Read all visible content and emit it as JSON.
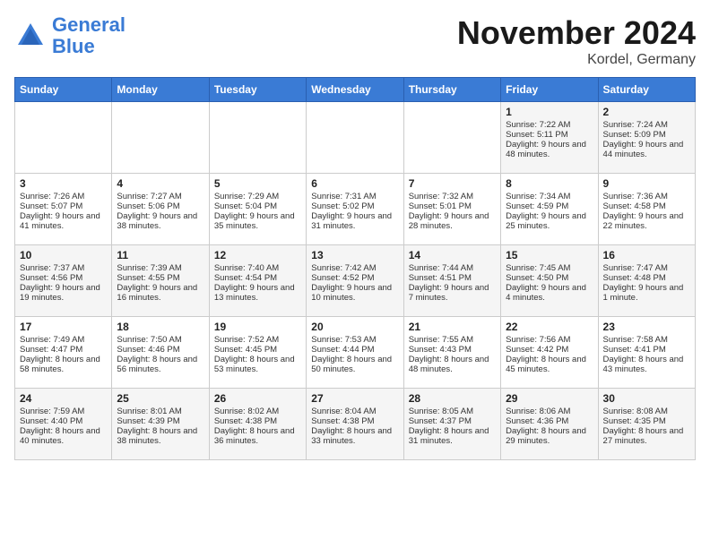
{
  "header": {
    "logo_line1": "General",
    "logo_line2": "Blue",
    "month": "November 2024",
    "location": "Kordel, Germany"
  },
  "days_of_week": [
    "Sunday",
    "Monday",
    "Tuesday",
    "Wednesday",
    "Thursday",
    "Friday",
    "Saturday"
  ],
  "weeks": [
    [
      {
        "day": "",
        "content": ""
      },
      {
        "day": "",
        "content": ""
      },
      {
        "day": "",
        "content": ""
      },
      {
        "day": "",
        "content": ""
      },
      {
        "day": "",
        "content": ""
      },
      {
        "day": "1",
        "content": "Sunrise: 7:22 AM\nSunset: 5:11 PM\nDaylight: 9 hours and 48 minutes."
      },
      {
        "day": "2",
        "content": "Sunrise: 7:24 AM\nSunset: 5:09 PM\nDaylight: 9 hours and 44 minutes."
      }
    ],
    [
      {
        "day": "3",
        "content": "Sunrise: 7:26 AM\nSunset: 5:07 PM\nDaylight: 9 hours and 41 minutes."
      },
      {
        "day": "4",
        "content": "Sunrise: 7:27 AM\nSunset: 5:06 PM\nDaylight: 9 hours and 38 minutes."
      },
      {
        "day": "5",
        "content": "Sunrise: 7:29 AM\nSunset: 5:04 PM\nDaylight: 9 hours and 35 minutes."
      },
      {
        "day": "6",
        "content": "Sunrise: 7:31 AM\nSunset: 5:02 PM\nDaylight: 9 hours and 31 minutes."
      },
      {
        "day": "7",
        "content": "Sunrise: 7:32 AM\nSunset: 5:01 PM\nDaylight: 9 hours and 28 minutes."
      },
      {
        "day": "8",
        "content": "Sunrise: 7:34 AM\nSunset: 4:59 PM\nDaylight: 9 hours and 25 minutes."
      },
      {
        "day": "9",
        "content": "Sunrise: 7:36 AM\nSunset: 4:58 PM\nDaylight: 9 hours and 22 minutes."
      }
    ],
    [
      {
        "day": "10",
        "content": "Sunrise: 7:37 AM\nSunset: 4:56 PM\nDaylight: 9 hours and 19 minutes."
      },
      {
        "day": "11",
        "content": "Sunrise: 7:39 AM\nSunset: 4:55 PM\nDaylight: 9 hours and 16 minutes."
      },
      {
        "day": "12",
        "content": "Sunrise: 7:40 AM\nSunset: 4:54 PM\nDaylight: 9 hours and 13 minutes."
      },
      {
        "day": "13",
        "content": "Sunrise: 7:42 AM\nSunset: 4:52 PM\nDaylight: 9 hours and 10 minutes."
      },
      {
        "day": "14",
        "content": "Sunrise: 7:44 AM\nSunset: 4:51 PM\nDaylight: 9 hours and 7 minutes."
      },
      {
        "day": "15",
        "content": "Sunrise: 7:45 AM\nSunset: 4:50 PM\nDaylight: 9 hours and 4 minutes."
      },
      {
        "day": "16",
        "content": "Sunrise: 7:47 AM\nSunset: 4:48 PM\nDaylight: 9 hours and 1 minute."
      }
    ],
    [
      {
        "day": "17",
        "content": "Sunrise: 7:49 AM\nSunset: 4:47 PM\nDaylight: 8 hours and 58 minutes."
      },
      {
        "day": "18",
        "content": "Sunrise: 7:50 AM\nSunset: 4:46 PM\nDaylight: 8 hours and 56 minutes."
      },
      {
        "day": "19",
        "content": "Sunrise: 7:52 AM\nSunset: 4:45 PM\nDaylight: 8 hours and 53 minutes."
      },
      {
        "day": "20",
        "content": "Sunrise: 7:53 AM\nSunset: 4:44 PM\nDaylight: 8 hours and 50 minutes."
      },
      {
        "day": "21",
        "content": "Sunrise: 7:55 AM\nSunset: 4:43 PM\nDaylight: 8 hours and 48 minutes."
      },
      {
        "day": "22",
        "content": "Sunrise: 7:56 AM\nSunset: 4:42 PM\nDaylight: 8 hours and 45 minutes."
      },
      {
        "day": "23",
        "content": "Sunrise: 7:58 AM\nSunset: 4:41 PM\nDaylight: 8 hours and 43 minutes."
      }
    ],
    [
      {
        "day": "24",
        "content": "Sunrise: 7:59 AM\nSunset: 4:40 PM\nDaylight: 8 hours and 40 minutes."
      },
      {
        "day": "25",
        "content": "Sunrise: 8:01 AM\nSunset: 4:39 PM\nDaylight: 8 hours and 38 minutes."
      },
      {
        "day": "26",
        "content": "Sunrise: 8:02 AM\nSunset: 4:38 PM\nDaylight: 8 hours and 36 minutes."
      },
      {
        "day": "27",
        "content": "Sunrise: 8:04 AM\nSunset: 4:38 PM\nDaylight: 8 hours and 33 minutes."
      },
      {
        "day": "28",
        "content": "Sunrise: 8:05 AM\nSunset: 4:37 PM\nDaylight: 8 hours and 31 minutes."
      },
      {
        "day": "29",
        "content": "Sunrise: 8:06 AM\nSunset: 4:36 PM\nDaylight: 8 hours and 29 minutes."
      },
      {
        "day": "30",
        "content": "Sunrise: 8:08 AM\nSunset: 4:35 PM\nDaylight: 8 hours and 27 minutes."
      }
    ]
  ]
}
